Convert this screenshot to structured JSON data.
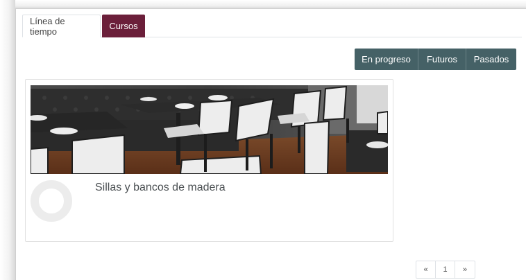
{
  "tabs": {
    "timeline": "Línea de tiempo",
    "courses": "Cursos",
    "active": "courses"
  },
  "filters": {
    "in_progress": "En progreso",
    "future": "Futuros",
    "past": "Pasados"
  },
  "course": {
    "title": "Sillas y bancos de madera",
    "progress": "0%",
    "image_icon": "restaurant-photo"
  },
  "pagination": {
    "prev": "«",
    "page": "1",
    "next": "»"
  },
  "colors": {
    "tab_active": "#6b1f3a",
    "filter_button": "#456166",
    "ring": "#ececec"
  }
}
